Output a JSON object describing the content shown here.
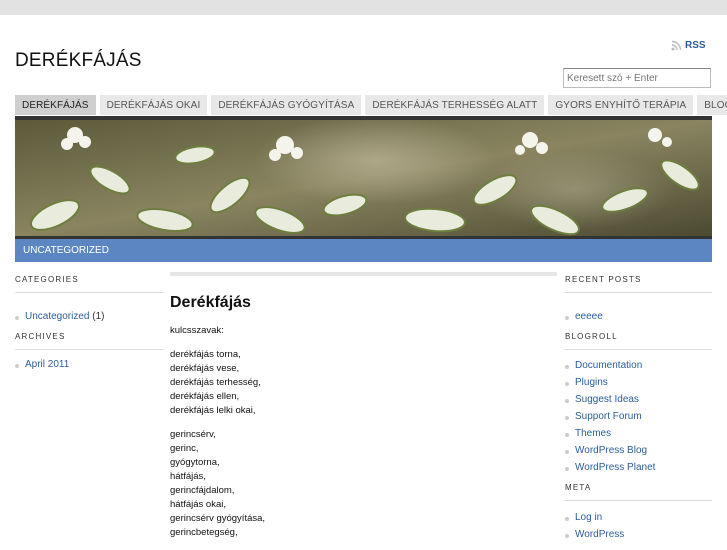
{
  "site": {
    "title": "DERÉKFÁJÁS",
    "rss_label": "RSS",
    "search_placeholder": "Keresett szó + Enter"
  },
  "nav": {
    "tabs": [
      {
        "label": "Derékfájás",
        "active": true
      },
      {
        "label": "Derékfájás okai"
      },
      {
        "label": "Derékfájás gyógyítása"
      },
      {
        "label": "Derékfájás terhesség alatt"
      },
      {
        "label": "Gyors enyhítő terápia"
      },
      {
        "label": "Blog"
      }
    ]
  },
  "category_bar": {
    "label": "Uncategorized"
  },
  "left_sidebar": {
    "categories_heading": "Categories",
    "categories": [
      {
        "label": "Uncategorized",
        "count": "(1)"
      }
    ],
    "archives_heading": "Archives",
    "archives": [
      {
        "label": "April 2011"
      }
    ]
  },
  "post": {
    "title": "Derékfájás",
    "keywords_label": "kulcsszavak:",
    "group1": [
      "derékfájás torna,",
      "derékfájás vese,",
      "derékfájás terhesség,",
      "derékfájás ellen,",
      "derékfájás lelki okai,"
    ],
    "group2": [
      "gerincsérv,",
      "gerinc,",
      "gyógytorna,",
      "hátfájás,",
      "gerincfájdalom,",
      "hátfájás okai,",
      "gerincsérv gyógyítása,",
      "gerincbetegség,"
    ]
  },
  "right_sidebar": {
    "recent_heading": "Recent Posts",
    "recent": [
      "eeeee"
    ],
    "blogroll_heading": "Blogroll",
    "blogroll": [
      "Documentation",
      "Plugins",
      "Suggest Ideas",
      "Support Forum",
      "Themes",
      "WordPress Blog",
      "WordPress Planet"
    ],
    "meta_heading": "Meta",
    "meta": [
      "Log in",
      "WordPress"
    ]
  },
  "colors": {
    "accent": "#5b86c2",
    "link": "#2a5d9c"
  }
}
